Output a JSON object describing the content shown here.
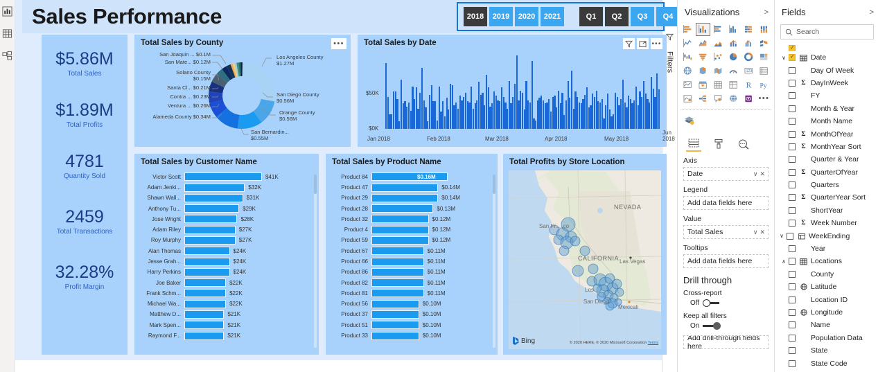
{
  "left_rail": [
    {
      "name": "report-view-icon",
      "label": "Report"
    },
    {
      "name": "data-view-icon",
      "label": "Data"
    },
    {
      "name": "model-view-icon",
      "label": "Model"
    }
  ],
  "report": {
    "title": "Sales Performance",
    "slicer_years": [
      {
        "label": "2018",
        "selected": true
      },
      {
        "label": "2019",
        "selected": false
      },
      {
        "label": "2020",
        "selected": false
      },
      {
        "label": "2021",
        "selected": false
      }
    ],
    "slicer_quarters": [
      {
        "label": "Q1",
        "selected": true
      },
      {
        "label": "Q2",
        "selected": true
      },
      {
        "label": "Q3",
        "selected": false
      },
      {
        "label": "Q4",
        "selected": false
      }
    ],
    "kpis": [
      {
        "value": "$5.86M",
        "label": "Total Sales"
      },
      {
        "value": "$1.89M",
        "label": "Total Profits"
      },
      {
        "value": "4781",
        "label": "Quantity Sold"
      },
      {
        "value": "2459",
        "label": "Total Transactions"
      },
      {
        "value": "32.28%",
        "label": "Profit Margin"
      }
    ],
    "kebab_glyph": "•••"
  },
  "chart_data": [
    {
      "type": "pie",
      "title": "Total Sales by County",
      "variant": "donut",
      "labels_format": "$M",
      "slices": [
        {
          "label": "Los Angeles County",
          "display": "$1.27M",
          "value": 1.27,
          "color": "#a8d3f5"
        },
        {
          "label": "San Diego County",
          "display": "$0.56M",
          "value": 0.56,
          "color": "#4aa6e8"
        },
        {
          "label": "Orange County",
          "display": "$0.56M",
          "value": 0.56,
          "color": "#1a9bf0"
        },
        {
          "label": "San Bernardin...",
          "display": "$0.55M",
          "value": 0.55,
          "color": "#1570e0"
        },
        {
          "label": "Alameda County",
          "display": "$0.34M",
          "value": 0.34,
          "color": "#1a4fd6"
        },
        {
          "label": "Ventura ...",
          "display": "$0.26M",
          "value": 0.26,
          "color": "#1f43b8"
        },
        {
          "label": "Contra ...",
          "display": "$0.23M",
          "value": 0.23,
          "color": "#18327f"
        },
        {
          "label": "Santa Cl...",
          "display": "$0.21M",
          "value": 0.21,
          "color": "#4a5f72"
        },
        {
          "label": "Solano County",
          "display": "$0.15M",
          "value": 0.15,
          "color": "#2f6d80"
        },
        {
          "label": "San Mate...",
          "display": "$0.12M",
          "value": 0.12,
          "color": "#0d2a5e"
        },
        {
          "label": "San Joaquin ...",
          "display": "$0.1M",
          "value": 0.1,
          "color": "#16325c"
        }
      ],
      "extra_slices": [
        {
          "color": "#f0a94c"
        },
        {
          "color": "#f5c98a"
        },
        {
          "color": "#9fd4c7"
        },
        {
          "color": "#3f8f8a"
        },
        {
          "color": "#2d6d68"
        },
        {
          "color": "#0b2240"
        }
      ],
      "legend": "none"
    },
    {
      "type": "bar",
      "title": "Total Sales by Date",
      "orientation": "vertical",
      "xlabel": "",
      "ylabel": "",
      "ylim": [
        0,
        70000
      ],
      "y_ticks": [
        "$0K",
        "$50K"
      ],
      "x_ticks": [
        "Jan 2018",
        "Feb 2018",
        "Mar 2018",
        "Apr 2018",
        "May 2018",
        "Jun 2018"
      ],
      "grid": false,
      "bar_color": "#1a67d8",
      "values": [
        62,
        30,
        14,
        14,
        35,
        35,
        28,
        7,
        46,
        24,
        26,
        21,
        25,
        17,
        40,
        28,
        39,
        19,
        34,
        57,
        27,
        20,
        7,
        32,
        41,
        26,
        26,
        8,
        40,
        16,
        26,
        12,
        29,
        18,
        42,
        41,
        22,
        25,
        19,
        31,
        27,
        30,
        34,
        26,
        25,
        40,
        19,
        24,
        27,
        44,
        32,
        34,
        22,
        51,
        39,
        21,
        24,
        35,
        31,
        27,
        26,
        39,
        30,
        25,
        19,
        45,
        24,
        30,
        42,
        69,
        27,
        36,
        34,
        18,
        45,
        27,
        25,
        64,
        10,
        8,
        27,
        29,
        31,
        27,
        24,
        25,
        28,
        16,
        30,
        31,
        20,
        36,
        24,
        34,
        13,
        27,
        45,
        29,
        55,
        19,
        35,
        30,
        25,
        24,
        28,
        32,
        39,
        20,
        22,
        33,
        30,
        36,
        26,
        25,
        28,
        10,
        22,
        33,
        18,
        12,
        14,
        34,
        30,
        22,
        28,
        46,
        25,
        20,
        31,
        28,
        24,
        27,
        40,
        22,
        35,
        30,
        45,
        33,
        28,
        25,
        49,
        38,
        30,
        52,
        37
      ]
    },
    {
      "type": "bar",
      "title": "Total Sales by Customer Name",
      "orientation": "horizontal",
      "bar_color": "#1a9bf0",
      "categories": [
        "Victor Scott",
        "Adam Jenki...",
        "Shawn Wall...",
        "Anthony Tu...",
        "Jose Wright",
        "Adam Riley",
        "Roy Murphy",
        "Alan Thomas",
        "Jesse Grah...",
        "Harry Perkins",
        "Joe Baker",
        "Frank Schm...",
        "Michael Wa...",
        "Matthew D...",
        "Mark Spen...",
        "Raymond F..."
      ],
      "value_labels": [
        "$41K",
        "$32K",
        "$31K",
        "$29K",
        "$28K",
        "$27K",
        "$27K",
        "$24K",
        "$24K",
        "$24K",
        "$22K",
        "$22K",
        "$22K",
        "$21K",
        "$21K",
        "$21K"
      ],
      "values": [
        41,
        32,
        31,
        29,
        28,
        27,
        27,
        24,
        24,
        24,
        22,
        22,
        22,
        21,
        21,
        21
      ],
      "max": 41
    },
    {
      "type": "bar",
      "title": "Total Sales by Product Name",
      "orientation": "horizontal",
      "bar_color": "#1a9bf0",
      "categories": [
        "Product 84",
        "Product 47",
        "Product 29",
        "Product 28",
        "Product 32",
        "Product 4",
        "Product 59",
        "Product 67",
        "Product 66",
        "Product 86",
        "Product 82",
        "Product 81",
        "Product 56",
        "Product 37",
        "Product 51",
        "Product 33"
      ],
      "value_labels": [
        "$0.16M",
        "$0.14M",
        "$0.14M",
        "$0.13M",
        "$0.12M",
        "$0.12M",
        "$0.12M",
        "$0.11M",
        "$0.11M",
        "$0.11M",
        "$0.11M",
        "$0.11M",
        "$0.10M",
        "$0.10M",
        "$0.10M",
        "$0.10M"
      ],
      "values": [
        0.16,
        0.14,
        0.14,
        0.13,
        0.12,
        0.12,
        0.12,
        0.11,
        0.11,
        0.11,
        0.11,
        0.11,
        0.1,
        0.1,
        0.1,
        0.1
      ],
      "max": 0.16
    },
    {
      "type": "scatter",
      "subtype": "map",
      "title": "Total Profits by Store Location",
      "basemap": "Bing",
      "map_labels": [
        "NEVADA",
        "CALIFORNIA",
        "San Francisco",
        "Las Vegas",
        "Los",
        "San Diego",
        "Mexicali"
      ],
      "attribution": "© 2020 HERE, © 2020 Microsoft Corporation",
      "attribution_link": "Terms",
      "bing_label": "Bing",
      "bubble_color": "#4a90d9"
    }
  ],
  "date_chart_icons": [
    {
      "name": "filter-icon"
    },
    {
      "name": "focus-mode-icon"
    },
    {
      "name": "more-options-icon"
    }
  ],
  "panes": {
    "filters_label": "Filters",
    "visualizations": {
      "title": "Visualizations",
      "collapse_glyph": ">",
      "expand_glyph": "<",
      "wells": {
        "tabs": [
          {
            "name": "fields-tab",
            "active": true
          },
          {
            "name": "format-tab",
            "active": false
          },
          {
            "name": "analytics-tab",
            "active": false
          }
        ],
        "items": [
          {
            "label": "Axis",
            "value": "Date",
            "empty": false
          },
          {
            "label": "Legend",
            "value": "Add data fields here",
            "empty": true
          },
          {
            "label": "Value",
            "value": "Total Sales",
            "empty": false
          },
          {
            "label": "Tooltips",
            "value": "Add data fields here",
            "empty": true
          }
        ],
        "dropdown_glyph": "∨",
        "remove_glyph": "✕"
      },
      "drill_through": {
        "title": "Drill through",
        "cross_report": {
          "label": "Cross-report",
          "state": "Off",
          "on": false
        },
        "keep_filters": {
          "label": "Keep all filters",
          "state": "On",
          "on": true
        },
        "drop_hint": "Add drill-through fields here"
      }
    },
    "fields": {
      "title": "Fields",
      "collapse_glyph": ">",
      "search_placeholder": "Search",
      "tables": [
        {
          "name": "Date",
          "icon": "calendar-icon",
          "expanded": true,
          "checked": true,
          "fields": [
            {
              "label": "Day Of Week",
              "measure": false
            },
            {
              "label": "DayInWeek",
              "measure": true
            },
            {
              "label": "FY",
              "measure": false
            },
            {
              "label": "Month & Year",
              "measure": false
            },
            {
              "label": "Month Name",
              "measure": false
            },
            {
              "label": "MonthOfYear",
              "measure": true
            },
            {
              "label": "MonthYear Sort",
              "measure": true
            },
            {
              "label": "Quarter & Year",
              "measure": false
            },
            {
              "label": "QuarterOfYear",
              "measure": true
            },
            {
              "label": "Quarters",
              "measure": false
            },
            {
              "label": "QuarterYear Sort",
              "measure": true
            },
            {
              "label": "ShortYear",
              "measure": false
            },
            {
              "label": "Week Number",
              "measure": true
            },
            {
              "label": "WeekEnding",
              "measure": false,
              "hierarchy": true
            },
            {
              "label": "Year",
              "measure": false
            }
          ]
        },
        {
          "name": "Locations",
          "icon": "table-icon",
          "expanded": true,
          "checked": false,
          "fields": [
            {
              "label": "County",
              "measure": false
            },
            {
              "label": "Latitude",
              "measure": false,
              "geo": true
            },
            {
              "label": "Location ID",
              "measure": false
            },
            {
              "label": "Longitude",
              "measure": false,
              "geo": true
            },
            {
              "label": "Name",
              "measure": false
            },
            {
              "label": "Population Data",
              "measure": false
            },
            {
              "label": "State",
              "measure": false
            },
            {
              "label": "State Code",
              "measure": false
            }
          ]
        }
      ]
    }
  }
}
